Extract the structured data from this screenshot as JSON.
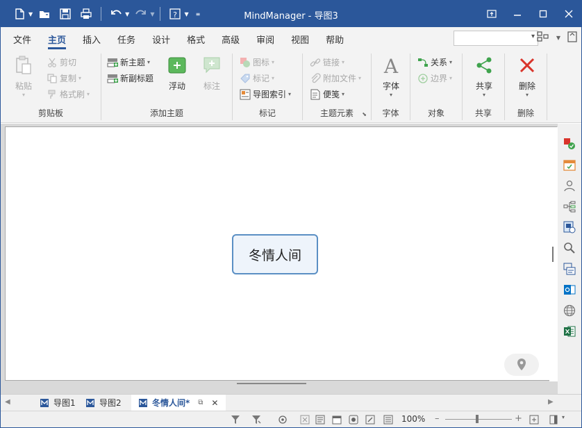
{
  "titlebar": {
    "title": "MindManager - 导图3"
  },
  "tabs": [
    "文件",
    "主页",
    "插入",
    "任务",
    "设计",
    "格式",
    "高级",
    "审阅",
    "视图",
    "帮助"
  ],
  "active_tab": "主页",
  "ribbon": {
    "clipboard": {
      "label": "剪贴板",
      "paste": "粘贴",
      "cut": "剪切",
      "copy": "复制",
      "format_painter": "格式刷"
    },
    "add_topic": {
      "label": "添加主题",
      "new_topic": "新主题",
      "new_subtopic": "新副标题",
      "float": "浮动",
      "callout": "标注"
    },
    "markers": {
      "label": "标记",
      "icon": "图标",
      "tag": "标记",
      "map_index": "导图索引"
    },
    "topic_elements": {
      "label": "主题元素",
      "link": "链接",
      "attach_file": "附加文件",
      "note": "便笺"
    },
    "font": {
      "label": "字体",
      "font": "字体"
    },
    "objects": {
      "label": "对象",
      "relationship": "关系",
      "boundary": "边界"
    },
    "share": {
      "label": "共享",
      "share": "共享"
    },
    "delete": {
      "label": "删除",
      "delete": "删除"
    }
  },
  "canvas": {
    "central_topic": "冬情人间"
  },
  "doc_tabs": [
    {
      "label": "导图1"
    },
    {
      "label": "导图2"
    },
    {
      "label": "冬情人间*"
    }
  ],
  "status": {
    "zoom": "100%"
  },
  "colors": {
    "brand": "#2b579a",
    "topic_border": "#5a8fc4",
    "topic_fill": "#eef4fb",
    "delete_red": "#d9342b",
    "share_green": "#3fa34d"
  }
}
